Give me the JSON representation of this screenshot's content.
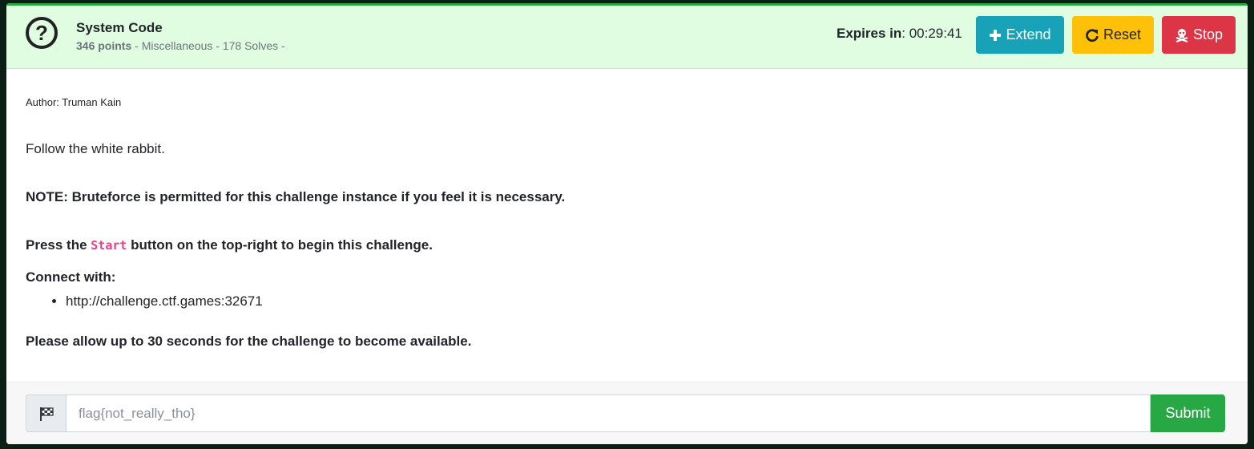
{
  "challenge": {
    "title": "System Code",
    "points": "346 points",
    "meta_rest": " - Miscellaneous - 178 Solves -",
    "expires_label": "Expires in",
    "expires_value": ": 00:29:41"
  },
  "buttons": {
    "extend": "Extend",
    "reset": "Reset",
    "stop": "Stop"
  },
  "body": {
    "author": "Author: Truman Kain",
    "description": "Follow the white rabbit.",
    "note": "NOTE: Bruteforce is permitted for this challenge instance if you feel it is necessary.",
    "press_pre": "Press the ",
    "press_code": "Start",
    "press_post": " button on the top-right to begin this challenge.",
    "connect_label": "Connect with:",
    "connect_url": "http://challenge.ctf.games:32671",
    "allow": "Please allow up to 30 seconds for the challenge to become available."
  },
  "flag": {
    "placeholder": "flag{not_really_tho}",
    "submit": "Submit"
  },
  "colors": {
    "header_bg": "#e1fde1",
    "extend": "#17a2b8",
    "reset": "#ffc107",
    "stop": "#dc3545",
    "submit": "#28a745",
    "code": "#e83e8c"
  },
  "icons": {
    "header": "question-circle-icon",
    "extend": "plus-icon",
    "reset": "redo-icon",
    "stop": "skull-crossbones-icon",
    "flag": "checkered-flag-icon"
  }
}
